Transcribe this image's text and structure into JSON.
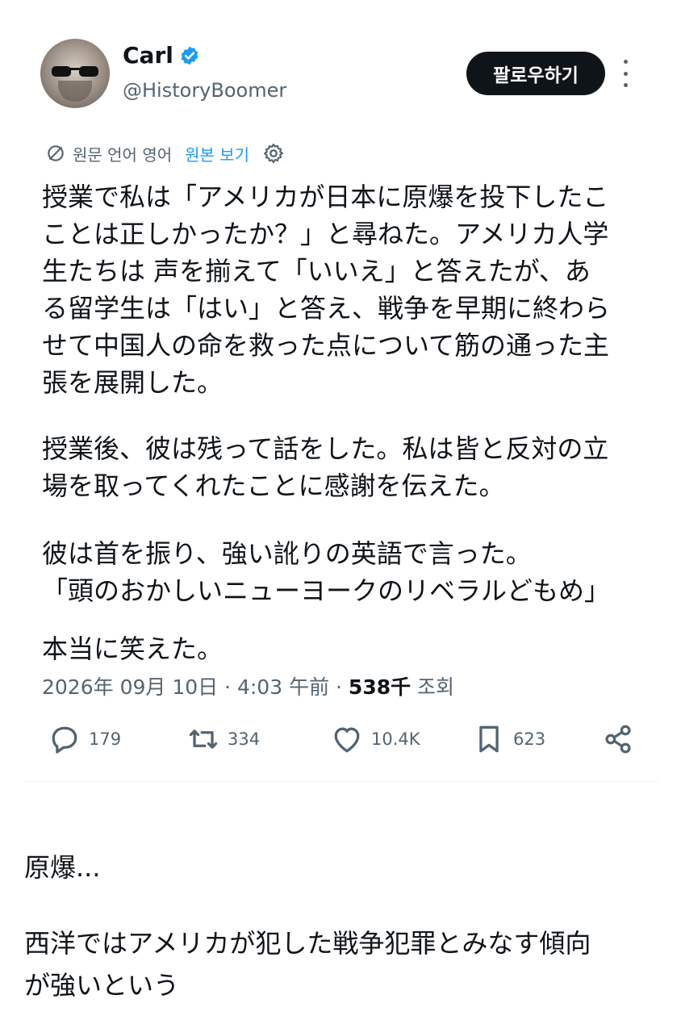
{
  "author": {
    "name": "Carl",
    "handle": "@HistoryBoomer",
    "verified": true,
    "follow_label": "팔로우하기"
  },
  "translation": {
    "label": "원문 언어 영어",
    "view_original": "원본 보기"
  },
  "tweet": {
    "lines": [
      "授業で私は「アメリカが日本に原爆を投下したこ",
      "ことは正しかったか？」と尋ねた。アメリカ人学",
      "生たちは 声を揃えて「いいえ」と答えたが、あ",
      "る留学生は「はい」と答え、戦争を早期に終わら",
      "せて中国人の命を救った点について筋の通った主",
      "張を展開した。",
      "授業後、彼は残って話をした。私は皆と反対の立",
      "場を取ってくれたことに感謝を伝えた。",
      "彼は首を振り、強い訛りの英語で言った。",
      "「頭のおかしいニューヨークのリベラルどもめ」",
      "本当に笑えた。"
    ]
  },
  "meta": {
    "datetime": "2026年 09月 10日 · 4:03 午前 · ",
    "views_count": "538千",
    "views_label": " 조회"
  },
  "actions": {
    "replies": "179",
    "reposts": "334",
    "likes": "10.4K",
    "bookmarks": "623"
  },
  "reply": {
    "lines": [
      "原爆...",
      "西洋ではアメリカが犯した戦争犯罪とみなす傾向",
      "が強いという"
    ]
  },
  "colors": {
    "accent": "#1d9bf0",
    "text": "#0f1419",
    "secondary": "#536471",
    "button_bg": "#0f1419"
  }
}
